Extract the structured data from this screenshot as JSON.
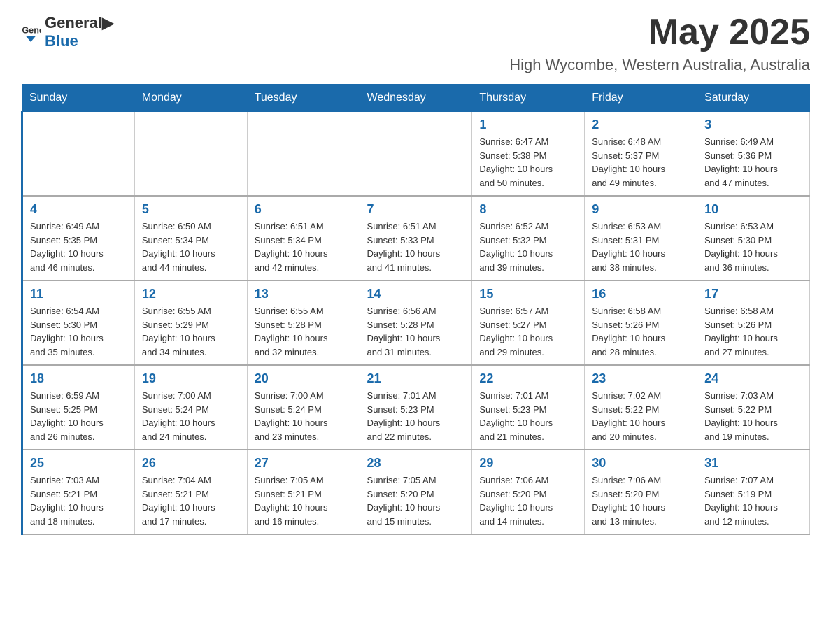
{
  "header": {
    "logo_general": "General",
    "logo_blue": "Blue",
    "month_title": "May 2025",
    "location": "High Wycombe, Western Australia, Australia"
  },
  "days_of_week": [
    "Sunday",
    "Monday",
    "Tuesday",
    "Wednesday",
    "Thursday",
    "Friday",
    "Saturday"
  ],
  "weeks": [
    [
      {
        "day": "",
        "info": ""
      },
      {
        "day": "",
        "info": ""
      },
      {
        "day": "",
        "info": ""
      },
      {
        "day": "",
        "info": ""
      },
      {
        "day": "1",
        "info": "Sunrise: 6:47 AM\nSunset: 5:38 PM\nDaylight: 10 hours\nand 50 minutes."
      },
      {
        "day": "2",
        "info": "Sunrise: 6:48 AM\nSunset: 5:37 PM\nDaylight: 10 hours\nand 49 minutes."
      },
      {
        "day": "3",
        "info": "Sunrise: 6:49 AM\nSunset: 5:36 PM\nDaylight: 10 hours\nand 47 minutes."
      }
    ],
    [
      {
        "day": "4",
        "info": "Sunrise: 6:49 AM\nSunset: 5:35 PM\nDaylight: 10 hours\nand 46 minutes."
      },
      {
        "day": "5",
        "info": "Sunrise: 6:50 AM\nSunset: 5:34 PM\nDaylight: 10 hours\nand 44 minutes."
      },
      {
        "day": "6",
        "info": "Sunrise: 6:51 AM\nSunset: 5:34 PM\nDaylight: 10 hours\nand 42 minutes."
      },
      {
        "day": "7",
        "info": "Sunrise: 6:51 AM\nSunset: 5:33 PM\nDaylight: 10 hours\nand 41 minutes."
      },
      {
        "day": "8",
        "info": "Sunrise: 6:52 AM\nSunset: 5:32 PM\nDaylight: 10 hours\nand 39 minutes."
      },
      {
        "day": "9",
        "info": "Sunrise: 6:53 AM\nSunset: 5:31 PM\nDaylight: 10 hours\nand 38 minutes."
      },
      {
        "day": "10",
        "info": "Sunrise: 6:53 AM\nSunset: 5:30 PM\nDaylight: 10 hours\nand 36 minutes."
      }
    ],
    [
      {
        "day": "11",
        "info": "Sunrise: 6:54 AM\nSunset: 5:30 PM\nDaylight: 10 hours\nand 35 minutes."
      },
      {
        "day": "12",
        "info": "Sunrise: 6:55 AM\nSunset: 5:29 PM\nDaylight: 10 hours\nand 34 minutes."
      },
      {
        "day": "13",
        "info": "Sunrise: 6:55 AM\nSunset: 5:28 PM\nDaylight: 10 hours\nand 32 minutes."
      },
      {
        "day": "14",
        "info": "Sunrise: 6:56 AM\nSunset: 5:28 PM\nDaylight: 10 hours\nand 31 minutes."
      },
      {
        "day": "15",
        "info": "Sunrise: 6:57 AM\nSunset: 5:27 PM\nDaylight: 10 hours\nand 29 minutes."
      },
      {
        "day": "16",
        "info": "Sunrise: 6:58 AM\nSunset: 5:26 PM\nDaylight: 10 hours\nand 28 minutes."
      },
      {
        "day": "17",
        "info": "Sunrise: 6:58 AM\nSunset: 5:26 PM\nDaylight: 10 hours\nand 27 minutes."
      }
    ],
    [
      {
        "day": "18",
        "info": "Sunrise: 6:59 AM\nSunset: 5:25 PM\nDaylight: 10 hours\nand 26 minutes."
      },
      {
        "day": "19",
        "info": "Sunrise: 7:00 AM\nSunset: 5:24 PM\nDaylight: 10 hours\nand 24 minutes."
      },
      {
        "day": "20",
        "info": "Sunrise: 7:00 AM\nSunset: 5:24 PM\nDaylight: 10 hours\nand 23 minutes."
      },
      {
        "day": "21",
        "info": "Sunrise: 7:01 AM\nSunset: 5:23 PM\nDaylight: 10 hours\nand 22 minutes."
      },
      {
        "day": "22",
        "info": "Sunrise: 7:01 AM\nSunset: 5:23 PM\nDaylight: 10 hours\nand 21 minutes."
      },
      {
        "day": "23",
        "info": "Sunrise: 7:02 AM\nSunset: 5:22 PM\nDaylight: 10 hours\nand 20 minutes."
      },
      {
        "day": "24",
        "info": "Sunrise: 7:03 AM\nSunset: 5:22 PM\nDaylight: 10 hours\nand 19 minutes."
      }
    ],
    [
      {
        "day": "25",
        "info": "Sunrise: 7:03 AM\nSunset: 5:21 PM\nDaylight: 10 hours\nand 18 minutes."
      },
      {
        "day": "26",
        "info": "Sunrise: 7:04 AM\nSunset: 5:21 PM\nDaylight: 10 hours\nand 17 minutes."
      },
      {
        "day": "27",
        "info": "Sunrise: 7:05 AM\nSunset: 5:21 PM\nDaylight: 10 hours\nand 16 minutes."
      },
      {
        "day": "28",
        "info": "Sunrise: 7:05 AM\nSunset: 5:20 PM\nDaylight: 10 hours\nand 15 minutes."
      },
      {
        "day": "29",
        "info": "Sunrise: 7:06 AM\nSunset: 5:20 PM\nDaylight: 10 hours\nand 14 minutes."
      },
      {
        "day": "30",
        "info": "Sunrise: 7:06 AM\nSunset: 5:20 PM\nDaylight: 10 hours\nand 13 minutes."
      },
      {
        "day": "31",
        "info": "Sunrise: 7:07 AM\nSunset: 5:19 PM\nDaylight: 10 hours\nand 12 minutes."
      }
    ]
  ]
}
